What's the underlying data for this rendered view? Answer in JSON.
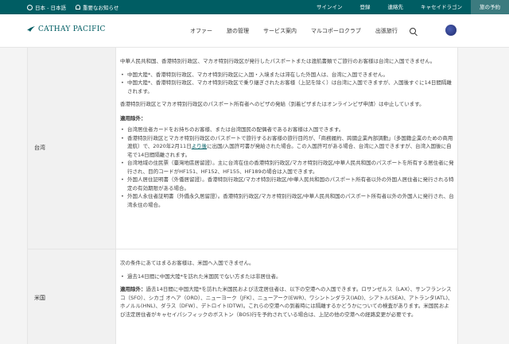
{
  "topbar": {
    "language": "日本 - 日本語",
    "notice": "重要なお知らせ",
    "links": [
      "サインイン",
      "登録",
      "連絡先",
      "キャセイドラゴン",
      "旅の予約"
    ]
  },
  "header": {
    "brand": "CATHAY PACIFIC",
    "nav": [
      "オファー",
      "旅の管理",
      "サービス案内",
      "マルコポーロクラブ",
      "出張旅行"
    ]
  },
  "colors": {
    "brand": "#005d63",
    "topbar": "#005d63",
    "label_bg": "#f1f1f1"
  },
  "rows": {
    "taiwan": {
      "label": "台湾",
      "intro": "中華人民共和国、香港特別行政区、マカオ特別行政区が発行したパスポートまたは渡航書類でご旅行のお客様は台湾に入国できません。",
      "bullets": [
        "中国大陸*、香港特別行政区、マカオ特別行政区に入国・入境または滞在した外国人は、台湾に入国できません。",
        "中国大陸*、香港特別行政区、マカオ特別行政区で乗り継ぎされたお客様（上記を除く）は台湾に入国できますが、入国後すぐに14日間隔離されます。"
      ],
      "visa_note": "香港特別行政区とマカオ特別行政区のパスポート所有者へのビザの発給（到着ビザまたはオンラインビザ申請）は中止しています。",
      "exceptions_title": "適用除外：",
      "exceptions": [
        "台湾居住者カードをお持ちのお客様、または台湾国民の配偶者であるお客様は入国できます。",
        "香港特別行政区とマカオ特別行政区のパスポートで旅行するお客様の旅行目的が、「商務履約、跨國企業內部調動」（多国籍企業のための商用渡航）で、2020年2月11日より後に出国/入国許可書が発給された場合。この入国許可がある場合、台湾に入国できますが、台湾入国後に自宅で14日間隔離されます。",
        "台湾地域の住民票（臺灣地區居留證）。主に台湾在住の香港特別行政区/マカオ特別行政区/中華人民共和国のパスポートを所有する居住者に発行され、目的コードがHF151、HF152、HF155、HF189の場合は入国できます。",
        "外国人居住証明書（外僑居留證）。香港特別行政区/マカオ特別行政区/中華人民共和国のパスポート所有者以外の外国人居住者に発行される特定の有効期限がある場合。",
        "外国人永住者証明書（外僑永久居留證）。香港特別行政区/マカオ特別行政区/中華人民共和国のパスポート所有者以外の外国人に発行され、台湾永住の場合。"
      ],
      "link_text": "より後"
    },
    "usa": {
      "label": "米国",
      "intro": "次の条件にあてはまるお客様は、米国へ入国できません。",
      "bullets": [
        "過去14日間に中国大陸*を訪れた米国民でない方または非居住者。"
      ],
      "exceptions_title": "適用除外：",
      "exceptions_text": "過去14日間に中国大陸*を訪れた米国民および法定居住者は、以下の空港への入国できます。ロサンゼルス（LAX）、サンフランシスコ（SFO）、シカゴ オヘア（ORD）、ニューヨーク（JFK）、ニューアーク(EWR)、ワシントンダラス(IAD)、シアトル(SEA)、アトランタ(ATL)、ホノルル(HNL)、ダラス（DFW）、デトロイト(DTW)。これらの空港への到着時には隔離するかどうかについての検査があります。米国民および法定居住者がキャセイパシフィックのボストン（BOS)行を予約されている場合は、上記の他の空港への経路変更が必要です。"
    }
  }
}
